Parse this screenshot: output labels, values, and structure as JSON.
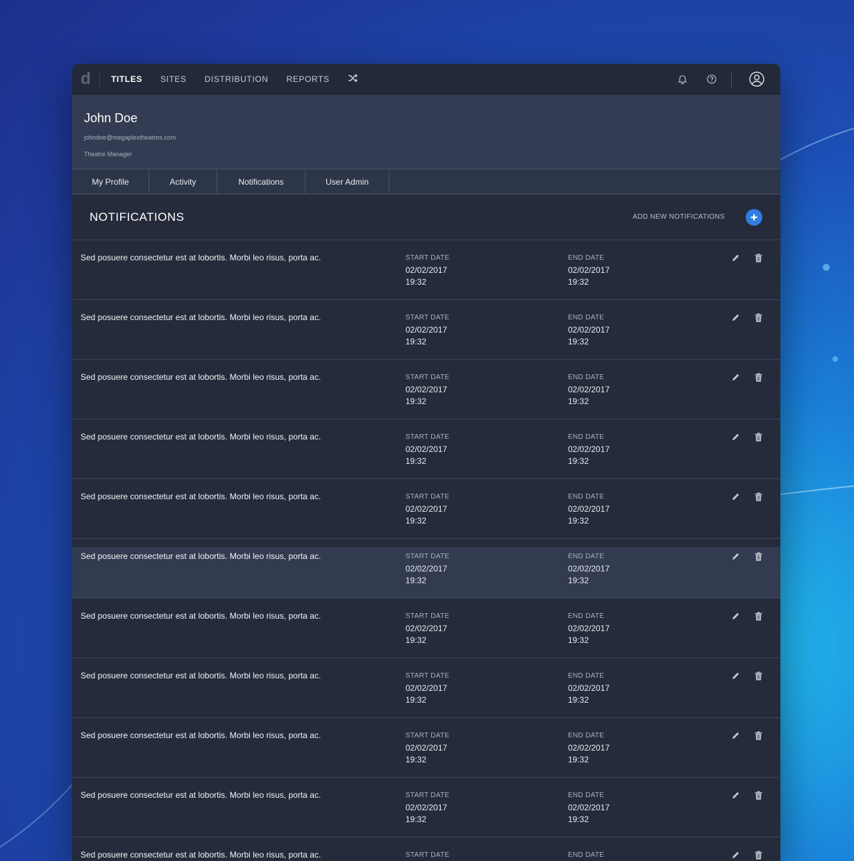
{
  "topbar": {
    "logo": "d",
    "nav": [
      "TITLES",
      "SITES",
      "DISTRIBUTION",
      "REPORTS"
    ],
    "active_nav": "TITLES"
  },
  "profile": {
    "name": "John Doe",
    "email": "johndoe@megaplextheatres.com",
    "role": "Theatre Manager"
  },
  "tabs": [
    "My Profile",
    "Activity",
    "Notifications",
    "User Admin"
  ],
  "section": {
    "title": "NOTIFICATIONS",
    "add_label": "ADD NEW NOTIFICATIONS"
  },
  "columns": {
    "start_label": "START DATE",
    "end_label": "END DATE"
  },
  "notifications": [
    {
      "message": "Sed posuere consectetur est at lobortis. Morbi leo risus, porta ac.",
      "start_date": "02/02/2017",
      "start_time": "19:32",
      "end_date": "02/02/2017",
      "end_time": "19:32"
    },
    {
      "message": "Sed posuere consectetur est at lobortis. Morbi leo risus, porta ac.",
      "start_date": "02/02/2017",
      "start_time": "19:32",
      "end_date": "02/02/2017",
      "end_time": "19:32"
    },
    {
      "message": "Sed posuere consectetur est at lobortis. Morbi leo risus, porta ac.",
      "start_date": "02/02/2017",
      "start_time": "19:32",
      "end_date": "02/02/2017",
      "end_time": "19:32"
    },
    {
      "message": "Sed posuere consectetur est at lobortis. Morbi leo risus, porta ac.",
      "start_date": "02/02/2017",
      "start_time": "19:32",
      "end_date": "02/02/2017",
      "end_time": "19:32"
    },
    {
      "message": "Sed posuere consectetur est at lobortis. Morbi leo risus, porta ac.",
      "start_date": "02/02/2017",
      "start_time": "19:32",
      "end_date": "02/02/2017",
      "end_time": "19:32"
    },
    {
      "message": "Sed posuere consectetur est at lobortis. Morbi leo risus, porta ac.",
      "start_date": "02/02/2017",
      "start_time": "19:32",
      "end_date": "02/02/2017",
      "end_time": "19:32",
      "highlighted": true
    },
    {
      "message": "Sed posuere consectetur est at lobortis. Morbi leo risus, porta ac.",
      "start_date": "02/02/2017",
      "start_time": "19:32",
      "end_date": "02/02/2017",
      "end_time": "19:32"
    },
    {
      "message": "Sed posuere consectetur est at lobortis. Morbi leo risus, porta ac.",
      "start_date": "02/02/2017",
      "start_time": "19:32",
      "end_date": "02/02/2017",
      "end_time": "19:32"
    },
    {
      "message": "Sed posuere consectetur est at lobortis. Morbi leo risus, porta ac.",
      "start_date": "02/02/2017",
      "start_time": "19:32",
      "end_date": "02/02/2017",
      "end_time": "19:32"
    },
    {
      "message": "Sed posuere consectetur est at lobortis. Morbi leo risus, porta ac.",
      "start_date": "02/02/2017",
      "start_time": "19:32",
      "end_date": "02/02/2017",
      "end_time": "19:32"
    },
    {
      "message": "Sed posuere consectetur est at lobortis. Morbi leo risus, porta ac.",
      "start_date": "",
      "start_time": "",
      "end_date": "",
      "end_time": ""
    }
  ],
  "colors": {
    "accent": "#2f7de0",
    "panel": "#252b3b",
    "header": "#333c52"
  },
  "icons": {
    "nav_extra": "shuffle-icon",
    "top_right": [
      "bell-icon",
      "help-icon",
      "user-account-icon"
    ],
    "row_actions": [
      "edit-pencil-icon",
      "trash-icon"
    ],
    "add": "plus-circle-icon"
  }
}
